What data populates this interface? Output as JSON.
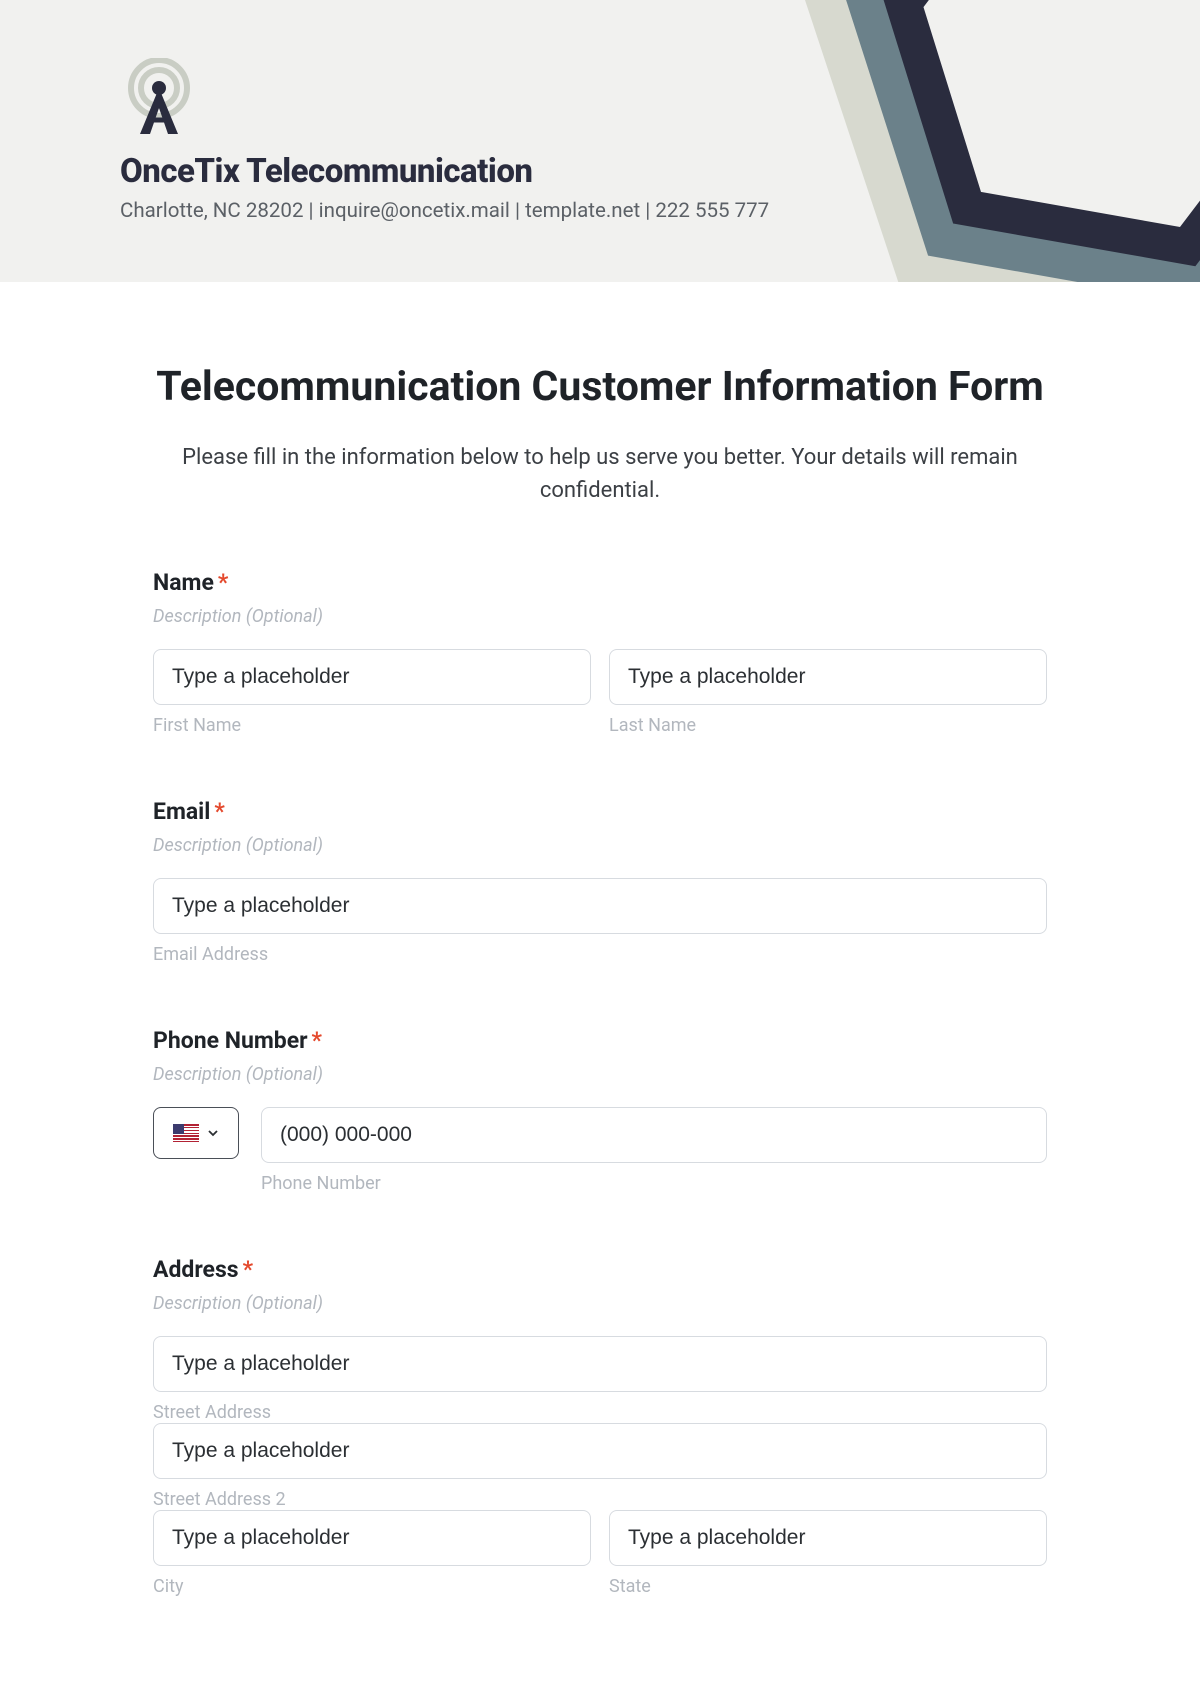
{
  "header": {
    "company_name": "OnceTix Telecommunication",
    "meta": "Charlotte, NC 28202 | inquire@oncetix.mail | template.net | 222 555 777"
  },
  "form": {
    "title": "Telecommunication Customer Information Form",
    "intro": "Please fill in the information below to help us serve you better. Your details will remain confidential.",
    "desc_placeholder": "Description (Optional)",
    "input_placeholder": "Type a placeholder",
    "phone_placeholder": "(000) 000-000",
    "name": {
      "label": "Name",
      "first": "First Name",
      "last": "Last Name"
    },
    "email": {
      "label": "Email",
      "sublabel": "Email Address"
    },
    "phone": {
      "label": "Phone Number",
      "sublabel": "Phone Number"
    },
    "address": {
      "label": "Address",
      "street": "Street Address",
      "street2": "Street Address 2",
      "city": "City",
      "state": "State"
    }
  }
}
